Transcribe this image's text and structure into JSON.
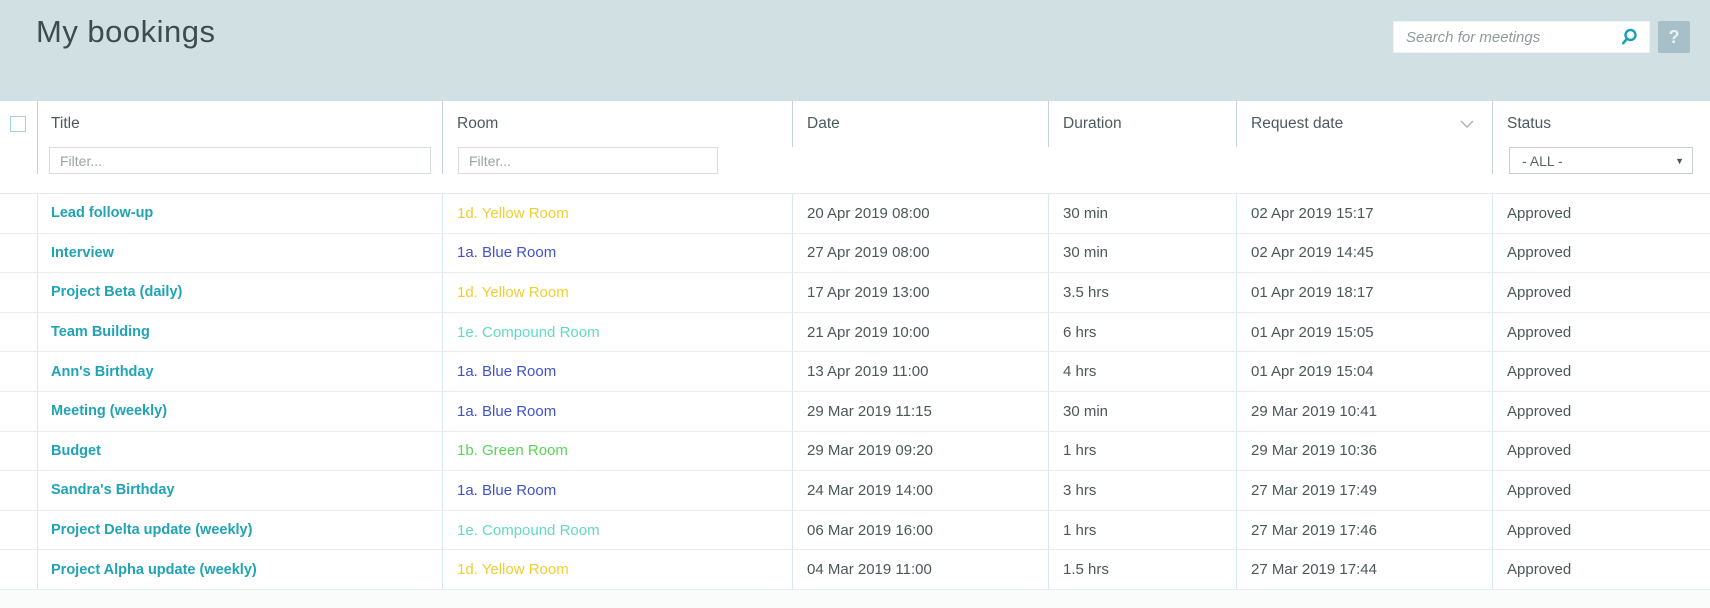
{
  "header": {
    "title": "My bookings",
    "search_placeholder": "Search for meetings",
    "help_label": "?"
  },
  "table": {
    "columns": [
      {
        "label": "Title"
      },
      {
        "label": "Room"
      },
      {
        "label": "Date"
      },
      {
        "label": "Duration"
      },
      {
        "label": "Request date",
        "sort_indicator": "chevron-down"
      },
      {
        "label": "Status"
      }
    ],
    "filters": {
      "title_placeholder": "Filter...",
      "room_placeholder": "Filter...",
      "status_value": "- ALL -"
    },
    "rows": [
      {
        "title": "Lead follow-up",
        "room": "1d. Yellow Room",
        "room_color": "#f0ce33",
        "date": "20 Apr 2019 08:00",
        "duration": "30 min",
        "request_date": "02 Apr 2019 15:17",
        "status": "Approved"
      },
      {
        "title": "Interview",
        "room": "1a. Blue Room",
        "room_color": "#4153cc",
        "date": "27 Apr 2019 08:00",
        "duration": "30 min",
        "request_date": "02 Apr 2019 14:45",
        "status": "Approved"
      },
      {
        "title": "Project Beta (daily)",
        "room": "1d. Yellow Room",
        "room_color": "#f0ce33",
        "date": "17 Apr 2019 13:00",
        "duration": "3.5 hrs",
        "request_date": "01 Apr 2019 18:17",
        "status": "Approved"
      },
      {
        "title": "Team Building",
        "room": "1e. Compound Room",
        "room_color": "#63d8c3",
        "date": "21 Apr 2019 10:00",
        "duration": "6 hrs",
        "request_date": "01 Apr 2019 15:05",
        "status": "Approved"
      },
      {
        "title": "Ann's Birthday",
        "room": "1a. Blue Room",
        "room_color": "#4153cc",
        "date": "13 Apr 2019 11:00",
        "duration": "4 hrs",
        "request_date": "01 Apr 2019 15:04",
        "status": "Approved"
      },
      {
        "title": "Meeting (weekly)",
        "room": "1a. Blue Room",
        "room_color": "#4153cc",
        "date": "29 Mar 2019 11:15",
        "duration": "30 min",
        "request_date": "29 Mar 2019 10:41",
        "status": "Approved"
      },
      {
        "title": "Budget",
        "room": "1b. Green Room",
        "room_color": "#58d655",
        "date": "29 Mar 2019 09:20",
        "duration": "1 hrs",
        "request_date": "29 Mar 2019 10:36",
        "status": "Approved"
      },
      {
        "title": "Sandra's Birthday",
        "room": "1a. Blue Room",
        "room_color": "#4153cc",
        "date": "24 Mar 2019 14:00",
        "duration": "3 hrs",
        "request_date": "27 Mar 2019 17:49",
        "status": "Approved"
      },
      {
        "title": "Project Delta update (weekly)",
        "room": "1e. Compound Room",
        "room_color": "#63d8c3",
        "date": "06 Mar 2019 16:00",
        "duration": "1 hrs",
        "request_date": "27 Mar 2019 17:46",
        "status": "Approved"
      },
      {
        "title": "Project Alpha update (weekly)",
        "room": "1d. Yellow Room",
        "room_color": "#f0ce33",
        "date": "04 Mar 2019 11:00",
        "duration": "1.5 hrs",
        "request_date": "27 Mar 2019 17:44",
        "status": "Approved"
      }
    ]
  },
  "colors": {
    "accent_teal": "#1fa3b5",
    "header_bg": "#d0e0e3",
    "room_yellow": "#f0ce33",
    "room_blue": "#4153cc",
    "room_aqua": "#63d8c3",
    "room_green": "#58d655",
    "body_text": "#4b5759"
  }
}
